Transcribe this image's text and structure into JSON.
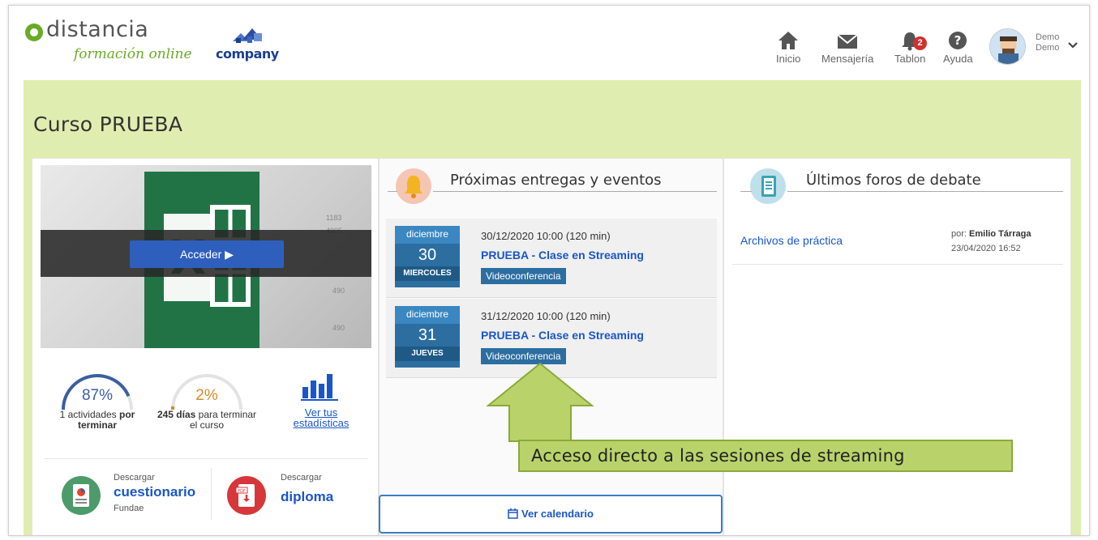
{
  "header": {
    "logo_text": "distancia",
    "logo_subtitle": "formación online",
    "company_logo_text": "company",
    "nav": [
      {
        "label": "Inicio",
        "icon": "home-icon"
      },
      {
        "label": "Mensajería",
        "icon": "envelope-icon"
      },
      {
        "label": "Tablon",
        "icon": "bell-icon",
        "badge": "2"
      },
      {
        "label": "Ayuda",
        "icon": "help-icon"
      }
    ],
    "user": {
      "first_name": "Demo",
      "last_name": "Demo"
    }
  },
  "course": {
    "title": "Curso PRUEBA",
    "access_button": "Acceder ▶",
    "stats": {
      "activities_percent": "87%",
      "activities_fraction": 0.87,
      "activities_count": "1 actividades",
      "activities_bold": "por terminar",
      "days_percent": "2%",
      "days_fraction": 0.02,
      "days_bold": "245 días",
      "days_rest": "para terminar el curso",
      "stats_link": "Ver tus estadísticas"
    },
    "downloads": [
      {
        "small": "Descargar",
        "big": "cuestionario",
        "sub": "Fundae",
        "icon": "questionnaire-icon"
      },
      {
        "small": "Descargar",
        "big": "diploma",
        "sub": "",
        "icon": "pdf-icon"
      }
    ]
  },
  "events": {
    "title": "Próximas entregas y eventos",
    "items": [
      {
        "month": "diciembre",
        "day": "30",
        "weekday": "MIERCOLES",
        "when": "30/12/2020 10:00 (120 min)",
        "title": "PRUEBA - Clase en Streaming",
        "tag": "Videoconferencia"
      },
      {
        "month": "diciembre",
        "day": "31",
        "weekday": "JUEVES",
        "when": "31/12/2020 10:00 (120 min)",
        "title": "PRUEBA - Clase en Streaming",
        "tag": "Videoconferencia"
      }
    ],
    "calendar_button": "Ver calendario"
  },
  "forums": {
    "title": "Últimos foros de debate",
    "items": [
      {
        "title": "Archivos de práctica",
        "by_label": "por:",
        "author": "Emilio Tárraga",
        "date": "23/04/2020 16:52"
      }
    ]
  },
  "callout": {
    "text": "Acceso directo a las sesiones de streaming"
  },
  "colors": {
    "brand_green": "#6aab26",
    "band_green": "#e0edb0",
    "link_blue": "#1a56c8",
    "date_blue": "#2d6ea1"
  }
}
